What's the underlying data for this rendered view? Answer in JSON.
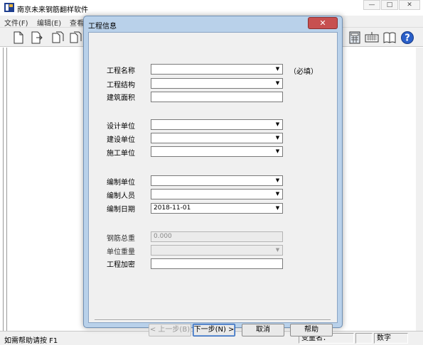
{
  "app": {
    "title": "南京未来钢筋翻样软件"
  },
  "window_controls": {
    "minimize": "—",
    "maximize": "□",
    "close": "✕"
  },
  "menu": [
    "文件(F)",
    "编辑(E)",
    "查看"
  ],
  "dialog": {
    "title": "工程信息",
    "close_label": "✕",
    "fields": {
      "project_name": {
        "label": "工程名称",
        "value": ""
      },
      "project_structure": {
        "label": "工程结构",
        "value": ""
      },
      "building_area": {
        "label": "建筑面积",
        "value": ""
      },
      "design_unit": {
        "label": "设计单位",
        "value": ""
      },
      "construction_unit": {
        "label": "建设单位",
        "value": ""
      },
      "builder_unit": {
        "label": "施工单位",
        "value": ""
      },
      "compile_unit": {
        "label": "编制单位",
        "value": ""
      },
      "compiler": {
        "label": "编制人员",
        "value": ""
      },
      "compile_date": {
        "label": "编制日期",
        "value": "2018-11-01"
      },
      "total_rebar_weight": {
        "label": "钢筋总重",
        "value": "0.000"
      },
      "unit_weight": {
        "label": "单位重量",
        "value": ""
      },
      "project_encrypt": {
        "label": "工程加密",
        "value": ""
      }
    },
    "required_note": "（必填）",
    "buttons": {
      "prev": "< 上一步(B)",
      "next": "下一步(N) >",
      "cancel": "取消",
      "help": "帮助"
    }
  },
  "statusbar": {
    "help_text": "如需帮助请按 F1",
    "variable_label": "变量名：",
    "mode": "数字"
  },
  "icons": [
    "new-file-icon",
    "open-icon",
    "copy-icon",
    "paste-icon",
    "calculator-icon",
    "keyboard-icon",
    "book-icon",
    "help-icon"
  ]
}
